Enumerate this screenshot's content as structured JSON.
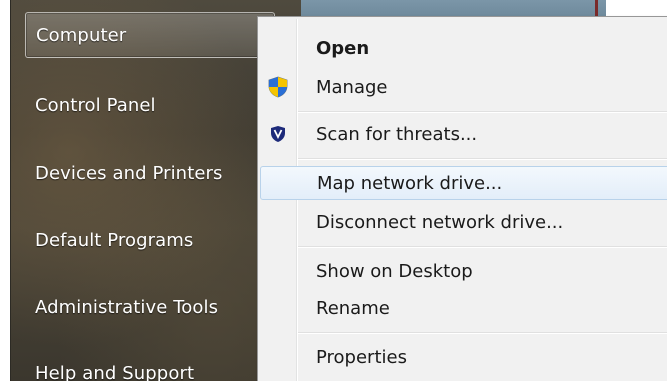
{
  "start_menu": {
    "items": [
      {
        "label": "Computer"
      },
      {
        "label": "Control Panel"
      },
      {
        "label": "Devices and Printers"
      },
      {
        "label": "Default Programs"
      },
      {
        "label": "Administrative Tools"
      },
      {
        "label": "Help and Support"
      }
    ]
  },
  "context_menu": {
    "items": [
      {
        "label": "Open",
        "icon": "none"
      },
      {
        "label": "Manage",
        "icon": "uac-shield-icon"
      },
      {
        "label": "Scan for threats...",
        "icon": "antivirus-shield-icon"
      },
      {
        "label": "Map network drive...",
        "icon": "none"
      },
      {
        "label": "Disconnect network drive...",
        "icon": "none"
      },
      {
        "label": "Show on Desktop",
        "icon": "none"
      },
      {
        "label": "Rename",
        "icon": "none"
      },
      {
        "label": "Properties",
        "icon": "none"
      }
    ]
  },
  "colors": {
    "menu_background": "#f1f1f1",
    "hover_border": "#b8d2ea",
    "start_pane": "#4a4437",
    "antivirus_icon": "#1d2a7a"
  }
}
